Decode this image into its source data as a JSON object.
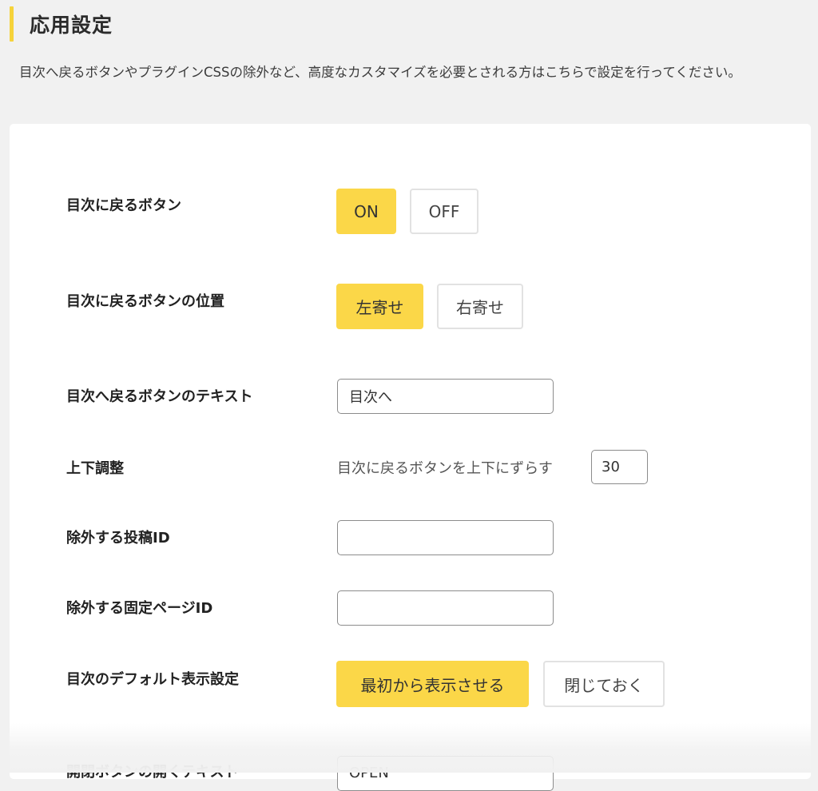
{
  "section": {
    "title": "応用設定",
    "description": "目次へ戻るボタンやプラグインCSSの除外など、高度なカスタマイズを必要とされる方はこちらで設定を行ってください。"
  },
  "settings": {
    "back_button": {
      "label": "目次に戻るボタン",
      "options": [
        "ON",
        "OFF"
      ],
      "selected": "ON"
    },
    "back_button_position": {
      "label": "目次に戻るボタンの位置",
      "options": [
        "左寄せ",
        "右寄せ"
      ],
      "selected": "左寄せ"
    },
    "back_button_text": {
      "label": "目次へ戻るボタンのテキスト",
      "value": "目次へ"
    },
    "vertical_adjust": {
      "label": "上下調整",
      "description": "目次に戻るボタンを上下にずらす",
      "value": "30"
    },
    "exclude_post_ids": {
      "label": "除外する投稿ID",
      "value": ""
    },
    "exclude_page_ids": {
      "label": "除外する固定ページID",
      "value": ""
    },
    "default_display": {
      "label": "目次のデフォルト表示設定",
      "options": [
        "最初から表示させる",
        "閉じておく"
      ],
      "selected": "最初から表示させる"
    },
    "toggle_open_text": {
      "label": "開閉ボタンの開くテキスト",
      "value": "OPEN"
    }
  },
  "colors": {
    "accent": "#fbd748",
    "background": "#f1f1f1",
    "panel": "#ffffff"
  }
}
